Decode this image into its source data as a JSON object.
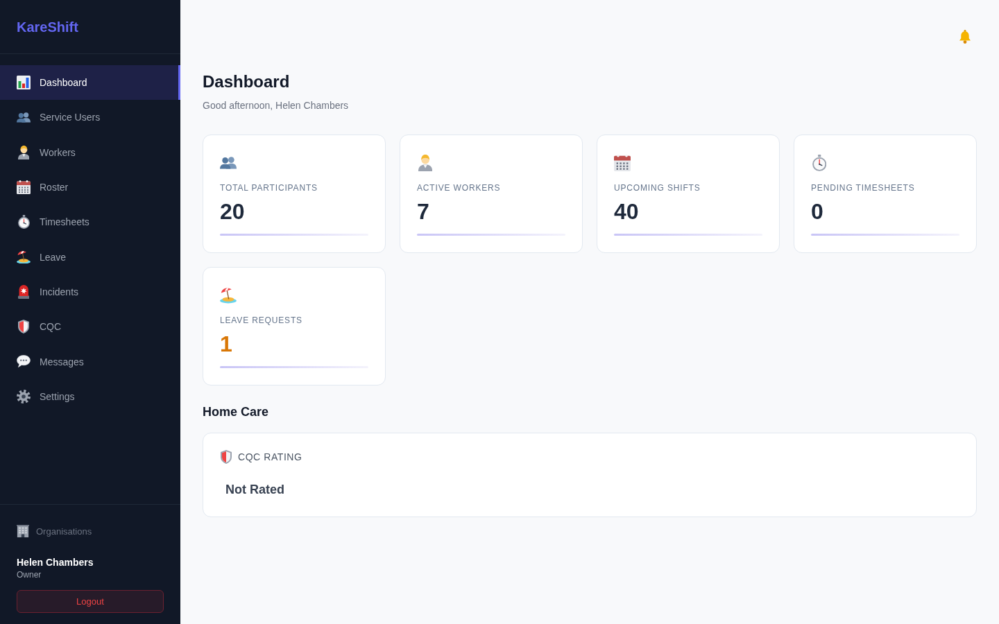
{
  "sidebar": {
    "logo": "KareShift",
    "items": [
      {
        "kind": "chart",
        "label": "Dashboard",
        "selected": true
      },
      {
        "kind": "people",
        "label": "Service Users",
        "selected": false
      },
      {
        "kind": "worker",
        "label": "Workers",
        "selected": false
      },
      {
        "kind": "calendar",
        "label": "Roster",
        "selected": false
      },
      {
        "kind": "stopwatch",
        "label": "Timesheets",
        "selected": false
      },
      {
        "kind": "beach",
        "label": "Leave",
        "selected": false
      },
      {
        "kind": "siren",
        "label": "Incidents",
        "selected": false
      },
      {
        "kind": "shield",
        "label": "CQC",
        "selected": false
      },
      {
        "kind": "chat",
        "label": "Messages",
        "selected": false
      },
      {
        "kind": "gear",
        "label": "Settings",
        "selected": false
      }
    ],
    "organisations_link": "Organisations",
    "user": {
      "name": "Helen Chambers",
      "role": "Owner"
    },
    "logout_button": "Logout"
  },
  "page": {
    "title": "Dashboard",
    "greeting": "Good afternoon, Helen Chambers"
  },
  "stats": [
    {
      "kind": "people",
      "label": "TOTAL PARTICIPANTS",
      "value": "20",
      "color": "#1e293b"
    },
    {
      "kind": "worker",
      "label": "ACTIVE WORKERS",
      "value": "7",
      "color": "#1e293b"
    },
    {
      "kind": "calendar",
      "label": "UPCOMING SHIFTS",
      "value": "40",
      "color": "#1e293b"
    },
    {
      "kind": "stopwatch",
      "label": "PENDING TIMESHEETS",
      "value": "0",
      "color": "#1e293b"
    },
    {
      "kind": "beach",
      "label": "LEAVE REQUESTS",
      "value": "1",
      "color": "#d97706"
    }
  ],
  "home_care": {
    "title": "Home Care",
    "cqc_rating": {
      "label": "CQC RATING",
      "value": "Not Rated"
    }
  }
}
